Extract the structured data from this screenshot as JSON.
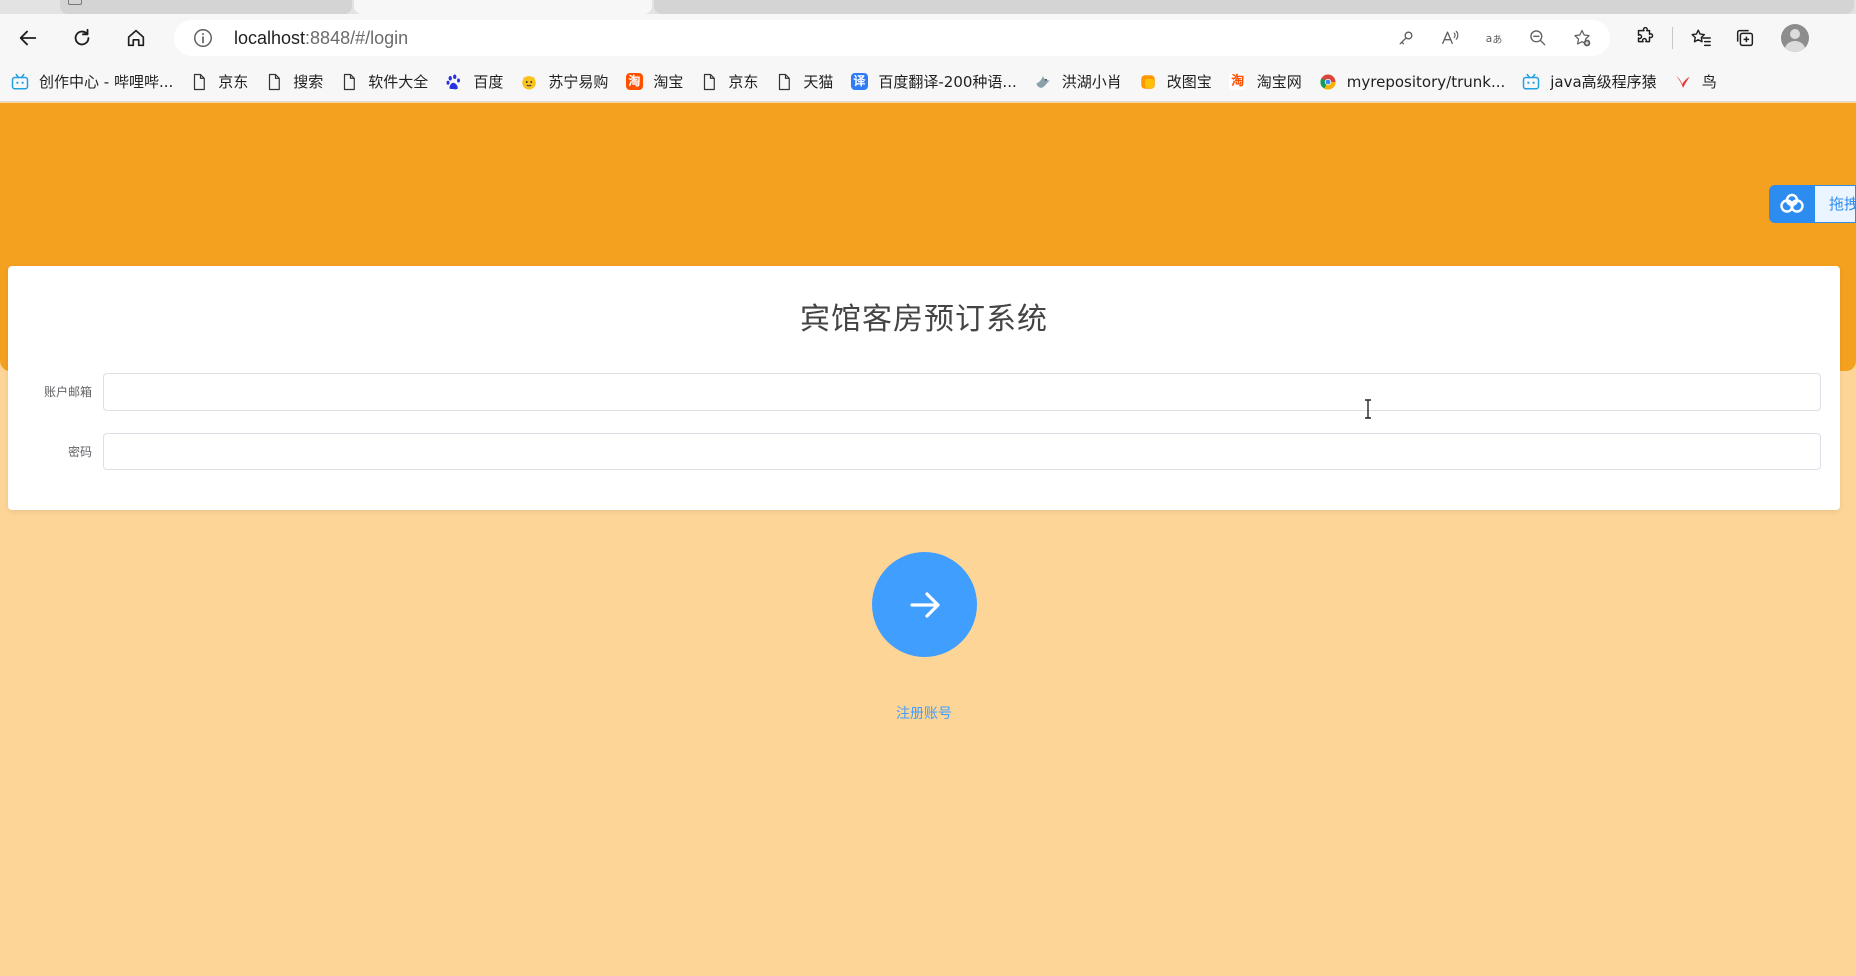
{
  "browser": {
    "url_host": "localhost",
    "url_rest": ":8848/#/login",
    "bookmarks": [
      {
        "label": "创作中心 - 哔哩哔...",
        "icon": "bilibili-icon"
      },
      {
        "label": "京东",
        "icon": "page-icon"
      },
      {
        "label": "搜索",
        "icon": "page-icon"
      },
      {
        "label": "软件大全",
        "icon": "page-icon"
      },
      {
        "label": "百度",
        "icon": "baidu-paw-icon"
      },
      {
        "label": "苏宁易购",
        "icon": "suning-icon"
      },
      {
        "label": "淘宝",
        "icon": "taobao-icon"
      },
      {
        "label": "京东",
        "icon": "page-icon"
      },
      {
        "label": "天猫",
        "icon": "page-icon"
      },
      {
        "label": "百度翻译-200种语...",
        "icon": "translate-icon"
      },
      {
        "label": "洪湖小肖",
        "icon": "bird-icon"
      },
      {
        "label": "改图宝",
        "icon": "gaitubao-icon"
      },
      {
        "label": "淘宝网",
        "icon": "taobao-icon"
      },
      {
        "label": "myrepository/trunk...",
        "icon": "chrome-icon"
      },
      {
        "label": "java高级程序猿",
        "icon": "bilibili-icon"
      },
      {
        "label": "鸟",
        "icon": "red-bird-icon"
      }
    ]
  },
  "page": {
    "title": "宾馆客房预订系统",
    "fields": [
      {
        "label": "账户邮箱",
        "value": ""
      },
      {
        "label": "密码",
        "value": ""
      }
    ],
    "register_link": "注册账号",
    "baidu_float_text": "拖拽"
  },
  "colors": {
    "header": "#f5a120",
    "background": "#fdd597",
    "accent": "#409eff"
  }
}
